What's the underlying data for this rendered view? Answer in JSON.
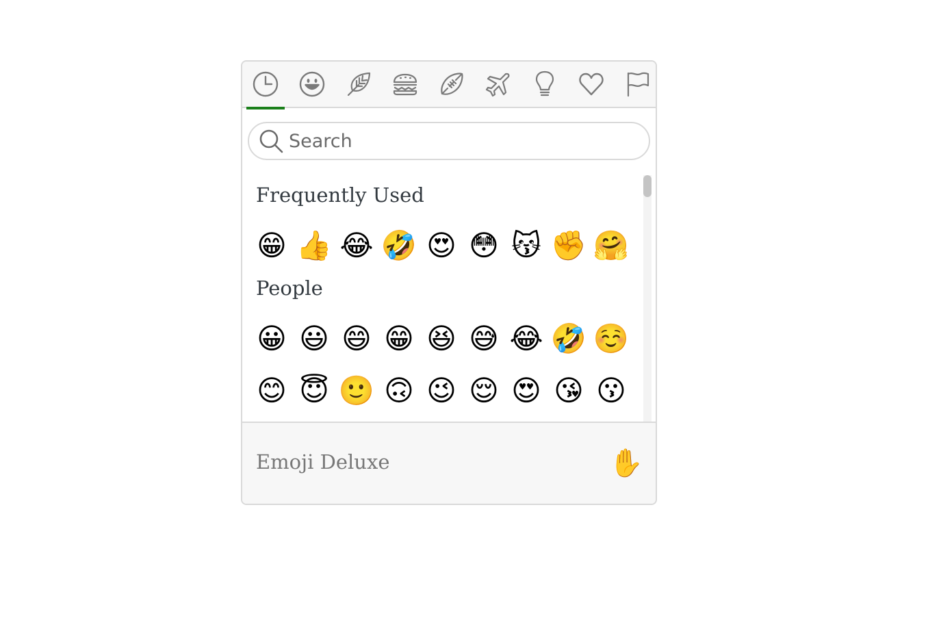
{
  "colors": {
    "accent": "#1a7f1a",
    "border": "#d9d9d9",
    "icon": "#7a7a7a"
  },
  "tabs": [
    {
      "name": "tab-recent",
      "icon": "clock-icon"
    },
    {
      "name": "tab-people",
      "icon": "smiley-icon"
    },
    {
      "name": "tab-nature",
      "icon": "leaf-icon"
    },
    {
      "name": "tab-food",
      "icon": "burger-icon"
    },
    {
      "name": "tab-activity",
      "icon": "football-icon"
    },
    {
      "name": "tab-travel",
      "icon": "airplane-icon"
    },
    {
      "name": "tab-objects",
      "icon": "lightbulb-icon"
    },
    {
      "name": "tab-symbols",
      "icon": "heart-icon"
    },
    {
      "name": "tab-flags",
      "icon": "flag-icon"
    }
  ],
  "active_tab": 0,
  "search": {
    "placeholder": "Search",
    "value": ""
  },
  "sections": [
    {
      "title": "Frequently Used",
      "rows": [
        [
          "😁",
          "👍",
          "😂",
          "🤣",
          "😍",
          "😳",
          "😽",
          "✊",
          "🤗"
        ]
      ]
    },
    {
      "title": "People",
      "rows": [
        [
          "😀",
          "😃",
          "😄",
          "😁",
          "😆",
          "😅",
          "😂",
          "🤣",
          "☺️"
        ],
        [
          "😊",
          "😇",
          "🙂",
          "🙃",
          "😉",
          "😌",
          "😍",
          "😘",
          "😗"
        ],
        [
          "😙",
          "😚",
          "😋",
          "😜",
          "😝",
          "😛",
          "🤑",
          "🤗",
          "🤓"
        ]
      ]
    }
  ],
  "footer": {
    "title": "Emoji Deluxe",
    "skin_tone": "✋"
  }
}
